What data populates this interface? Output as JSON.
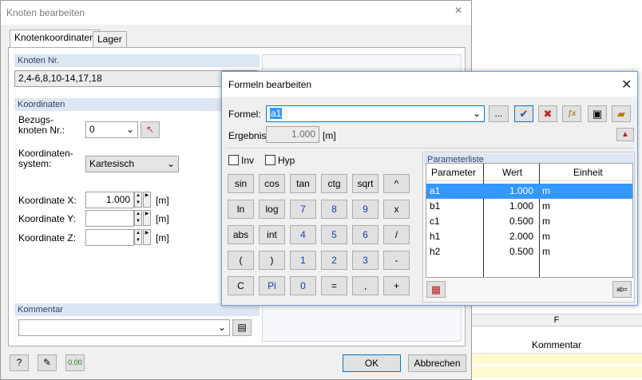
{
  "dialog_main": {
    "title": "Knoten bearbeiten",
    "tabs": [
      "Knotenkoordinaten",
      "Lager"
    ],
    "knoten_nr": {
      "header": "Knoten Nr.",
      "value": "2,4-6,8,10-14,17,18"
    },
    "koordinaten": {
      "header": "Koordinaten",
      "bezugsknoten_label": "Bezugs-\nknoten Nr.:",
      "bezugsknoten_value": "0",
      "system_label": "Koordinaten-\nsystem:",
      "system_value": "Kartesisch",
      "x_label": "Koordinate X:",
      "x_value": "1.000",
      "y_label": "Koordinate Y:",
      "y_value": "",
      "z_label": "Koordinate Z:",
      "z_value": "",
      "unit": "[m]"
    },
    "kommentar": {
      "header": "Kommentar",
      "value": ""
    },
    "ok_label": "OK",
    "cancel_label": "Abbrechen",
    "unit_badge": "0.00"
  },
  "dialog_formula": {
    "title": "Formeln bearbeiten",
    "formel_label": "Formel:",
    "formel_value": "a1",
    "dots_label": "...",
    "ergebnis_label": "Ergebnis:",
    "ergebnis_value": "1.000",
    "ergebnis_unit": "[m]",
    "inv_label": "Inv",
    "hyp_label": "Hyp",
    "calc_rows": [
      [
        "sin",
        "cos",
        "tan",
        "ctg",
        "sqrt",
        "^"
      ],
      [
        "ln",
        "log",
        "7",
        "8",
        "9",
        "x"
      ],
      [
        "abs",
        "int",
        "4",
        "5",
        "6",
        "/"
      ],
      [
        "(",
        ")",
        "1",
        "2",
        "3",
        "-"
      ],
      [
        "C",
        "Pi",
        "0",
        "=",
        ",",
        "+"
      ]
    ],
    "param_header": "Parameterliste",
    "param_columns": [
      "Parameter",
      "Wert",
      "Einheit"
    ],
    "params": [
      {
        "name": "a1",
        "value": "1.000",
        "unit": "m"
      },
      {
        "name": "b1",
        "value": "1.000",
        "unit": "m"
      },
      {
        "name": "c1",
        "value": "0.500",
        "unit": "m"
      },
      {
        "name": "h1",
        "value": "2.000",
        "unit": "m"
      },
      {
        "name": "h2",
        "value": "0.500",
        "unit": "m"
      }
    ]
  },
  "background": {
    "column_f": "F",
    "kommentar_col": "Kommentar"
  },
  "colors": {
    "accent": "#3399ff",
    "group_header": "#dde7f3",
    "badge": "#2a7a2a"
  }
}
